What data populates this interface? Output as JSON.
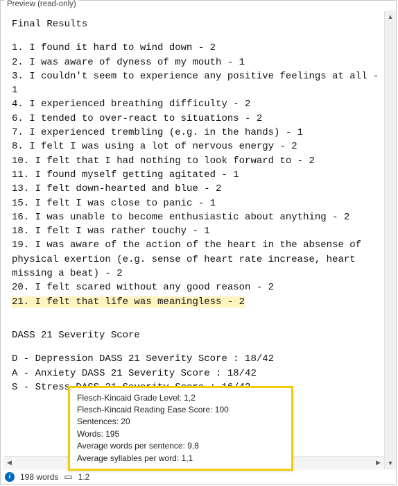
{
  "panel": {
    "title": "Preview (read-only)"
  },
  "content": {
    "heading": "Final Results",
    "items": [
      "1. I found it hard to wind down - 2",
      "2. I was aware of dyness of my mouth - 1",
      "3. I couldn't seem to experience any positive feelings at all - 1",
      "4. I experienced breathing difficulty - 2",
      "6. I tended to over-react to situations - 2",
      "7. I experienced trembling (e.g. in the hands) - 1",
      "8. I felt I was using a lot of nervous energy - 2",
      "10. I felt that I had nothing to look forward to - 2",
      "11. I found myself getting agitated - 1",
      "13. I felt down-hearted and blue - 2",
      "15. I felt I was close to panic - 1",
      "16. I was unable to become enthusiastic about anything - 2",
      "18. I felt I was rather touchy - 1",
      "19. I was aware of the action of the heart in the absense of physical exertion (e.g. sense of heart rate increase, heart missing a beat) - 2",
      "20. I felt scared without any good reason - 2"
    ],
    "highlighted_item": "21. I felt that life was meaningless - 2",
    "section2_heading": "DASS 21 Severity Score",
    "scores": [
      "D - Depression DASS 21 Severity Score : 18/42",
      "A - Anxiety DASS 21 Severity Score : 18/42",
      "S - Stress DASS 21 Severity Score : 16/42"
    ]
  },
  "tooltip": {
    "lines": [
      "Flesch-Kincaid Grade Level: 1,2",
      "Flesch-Kincaid Reading Ease Score: 100",
      "Sentences: 20",
      "Words: 195",
      "Average words per sentence: 9,8",
      "Average syllables per word: 1,1"
    ]
  },
  "status": {
    "words": "198 words",
    "grade": "1.2"
  }
}
